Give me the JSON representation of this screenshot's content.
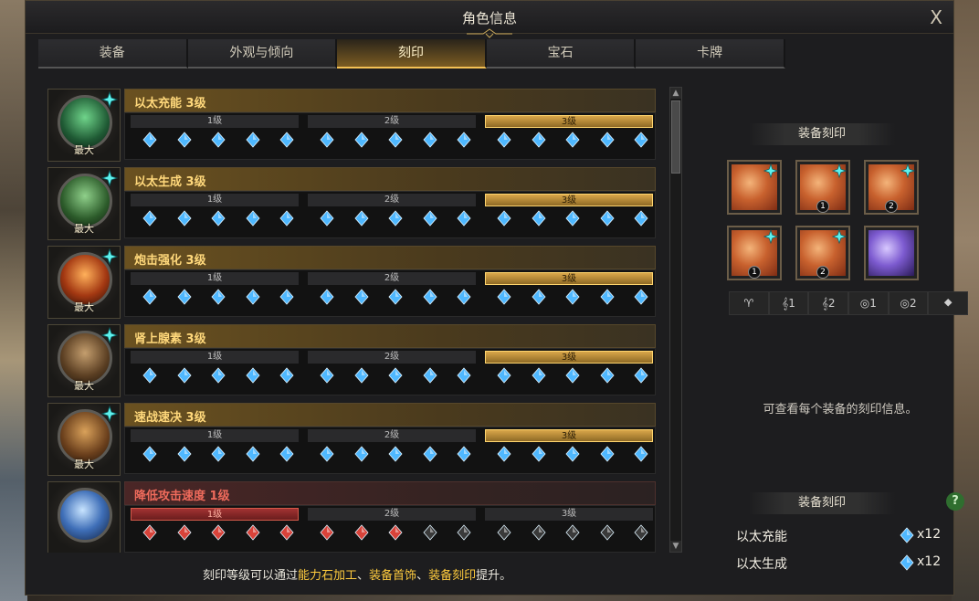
{
  "window": {
    "title": "角色信息",
    "close_label": "X"
  },
  "tabs": [
    {
      "label": "装备",
      "active": false
    },
    {
      "label": "外观与倾向",
      "active": false
    },
    {
      "label": "刻印",
      "active": true
    },
    {
      "label": "宝石",
      "active": false
    },
    {
      "label": "卡牌",
      "active": false
    }
  ],
  "engravings": [
    {
      "name": "以太充能 3级",
      "max_label": "最大",
      "icon": "green-claw-icon",
      "levels": [
        "1级",
        "2级",
        "3级"
      ],
      "active_level": 3,
      "filled": 15,
      "negative": false
    },
    {
      "name": "以太生成 3级",
      "max_label": "最大",
      "icon": "green-figure-icon",
      "levels": [
        "1级",
        "2级",
        "3级"
      ],
      "active_level": 3,
      "filled": 15,
      "negative": false
    },
    {
      "name": "炮击强化 3级",
      "max_label": "最大",
      "icon": "flame-slash-icon",
      "levels": [
        "1级",
        "2级",
        "3级"
      ],
      "active_level": 3,
      "filled": 15,
      "negative": false
    },
    {
      "name": "肾上腺素 3级",
      "max_label": "最大",
      "icon": "warrior-icon",
      "levels": [
        "1级",
        "2级",
        "3级"
      ],
      "active_level": 3,
      "filled": 15,
      "negative": false
    },
    {
      "name": "速战速决 3级",
      "max_label": "最大",
      "icon": "runner-icon",
      "levels": [
        "1级",
        "2级",
        "3级"
      ],
      "active_level": 3,
      "filled": 15,
      "negative": false
    },
    {
      "name": "降低攻击速度 1级",
      "max_label": "",
      "icon": "chained-orb-icon",
      "levels": [
        "1级",
        "2级",
        "3级"
      ],
      "active_level": 1,
      "filled": 8,
      "negative": true
    }
  ],
  "footer": {
    "prefix": "刻印等级可以通过",
    "highlight1": "能力石加工",
    "sep1": "、",
    "highlight2": "装备首饰",
    "sep2": "、",
    "highlight3": "装备刻印",
    "suffix": "提升。"
  },
  "right": {
    "equip_head": "装备刻印",
    "equipment": [
      {
        "name": "necklace-icon",
        "num": "",
        "gem": true,
        "style": "orange"
      },
      {
        "name": "earring-icon",
        "num": "1",
        "gem": true,
        "style": "orange"
      },
      {
        "name": "earring-icon",
        "num": "2",
        "gem": true,
        "style": "orange"
      },
      {
        "name": "ring-icon",
        "num": "1",
        "gem": true,
        "style": "orange"
      },
      {
        "name": "ring-icon",
        "num": "2",
        "gem": true,
        "style": "orange"
      },
      {
        "name": "stone-icon",
        "num": "",
        "gem": false,
        "style": "purple"
      }
    ],
    "slots": [
      "♈",
      "𝄞1",
      "𝄞2",
      "◎1",
      "◎2",
      "⯁"
    ],
    "hint": "可查看每个装备的刻印信息。",
    "summary_head": "装备刻印",
    "help_label": "?",
    "summary": [
      {
        "name": "以太充能",
        "count": "x12"
      },
      {
        "name": "以太生成",
        "count": "x12"
      }
    ]
  },
  "colors": {
    "gold": "#ffd87b",
    "red": "#f06b5c",
    "gem_blue": "#4fb8ff",
    "gem_red": "#d8433a"
  }
}
